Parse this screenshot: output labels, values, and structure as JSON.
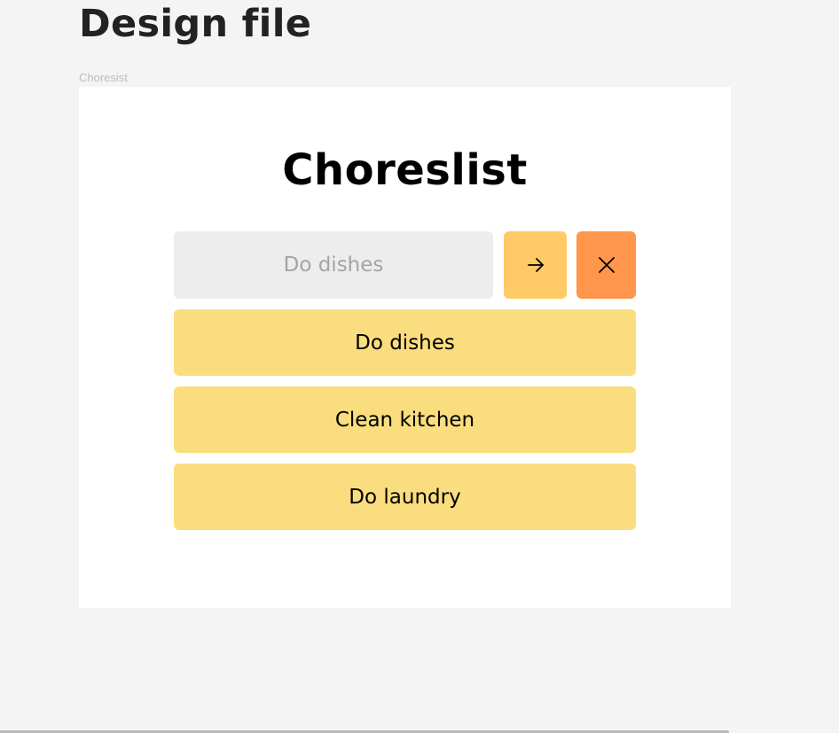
{
  "page": {
    "title": "Design file"
  },
  "frame": {
    "label": "Choresist"
  },
  "app": {
    "title": "Choreslist",
    "input": {
      "placeholder": "Do dishes",
      "value": ""
    },
    "buttons": {
      "add_icon": "arrow-right-icon",
      "clear_icon": "close-icon"
    },
    "chores": [
      "Do dishes",
      "Clean kitchen",
      "Do laundry"
    ]
  },
  "colors": {
    "background": "#f4f4f4",
    "frame": "#ffffff",
    "input_bg": "#ededed",
    "add_button": "#ffc966",
    "clear_button": "#ff964c",
    "chore_item": "#fadd7e"
  }
}
